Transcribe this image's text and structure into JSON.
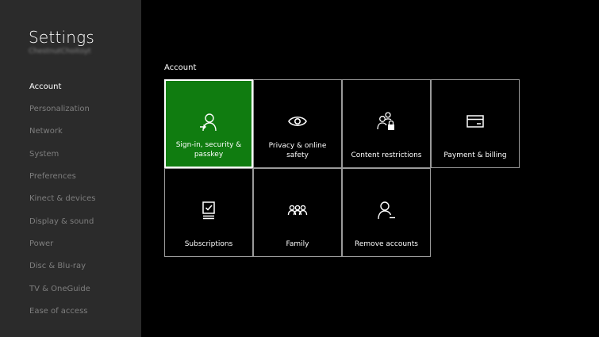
{
  "sidebar": {
    "title": "Settings",
    "gamertag": "ChestnutChoitoyt",
    "items": [
      {
        "label": "Account"
      },
      {
        "label": "Personalization"
      },
      {
        "label": "Network"
      },
      {
        "label": "System"
      },
      {
        "label": "Preferences"
      },
      {
        "label": "Kinect & devices"
      },
      {
        "label": "Display & sound"
      },
      {
        "label": "Power"
      },
      {
        "label": "Disc & Blu-ray"
      },
      {
        "label": "TV & OneGuide"
      },
      {
        "label": "Ease of access"
      }
    ]
  },
  "main": {
    "section_title": "Account",
    "tiles": [
      {
        "label": "Sign-in, security & passkey",
        "icon": "person-signin-icon"
      },
      {
        "label": "Privacy & online safety",
        "icon": "eye-icon"
      },
      {
        "label": "Content restrictions",
        "icon": "people-lock-icon"
      },
      {
        "label": "Payment & billing",
        "icon": "credit-card-icon"
      },
      {
        "label": "Subscriptions",
        "icon": "checklist-icon"
      },
      {
        "label": "Family",
        "icon": "family-icon"
      },
      {
        "label": "Remove accounts",
        "icon": "person-remove-icon"
      }
    ]
  },
  "colors": {
    "accent": "#107c10",
    "sidebar_bg": "#2b2b2b",
    "background": "#000000"
  }
}
